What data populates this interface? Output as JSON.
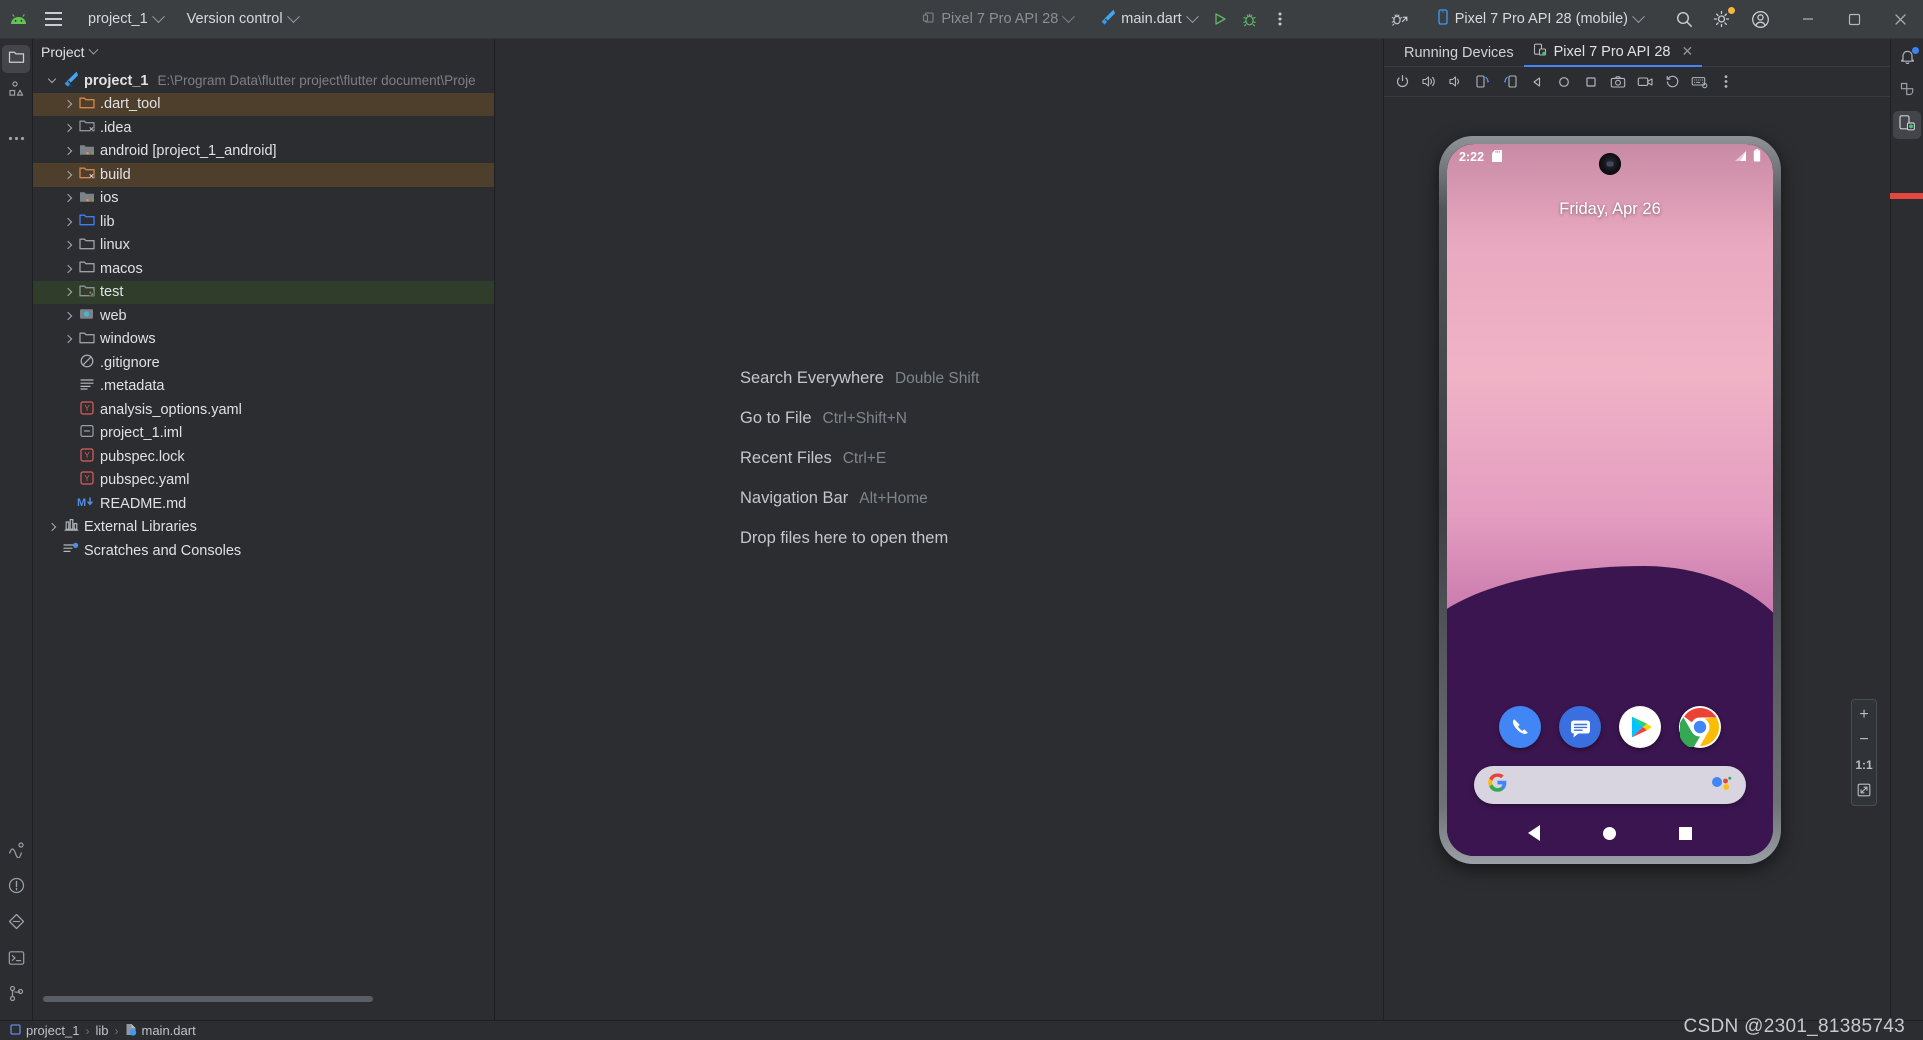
{
  "titlebar": {
    "logo_icon": "android-logo-icon",
    "menu_icon": "hamburger-menu-icon",
    "project_name": "project_1",
    "version_control": "Version control",
    "device_selector_left": "Pixel 7 Pro API 28",
    "run_config": "main.dart",
    "run_icon": "run-play-icon",
    "debug_icon": "debug-bug-icon",
    "more_icon": "more-vertical-icon",
    "flutter_icon": "flutter-logo-icon",
    "device_icon": "device-phone-icon",
    "settings_sync_icon": "debug-attach-icon",
    "device_selector_right": "Pixel 7 Pro API 28 (mobile)",
    "search_icon": "search-icon",
    "settings_icon": "gear-icon",
    "account_icon": "user-account-icon",
    "minimize_icon": "minimize-icon",
    "maximize_icon": "maximize-restore-icon",
    "close_icon": "close-icon"
  },
  "left_rail": {
    "items": [
      {
        "name": "project-tool-window",
        "icon": "folder-icon",
        "active": true
      },
      {
        "name": "structure-tool-window",
        "icon": "structure-shapes-icon",
        "active": false
      },
      {
        "name": "more-tool-windows",
        "icon": "ellipsis-icon",
        "active": false
      }
    ],
    "bottom_items": [
      {
        "name": "profiler-tool-window",
        "icon": "profiler-icon"
      },
      {
        "name": "problems-tool-window",
        "icon": "warning-circle-icon"
      },
      {
        "name": "flutter-inspector",
        "icon": "flutter-diamond-icon"
      },
      {
        "name": "terminal-tool-window",
        "icon": "terminal-icon"
      },
      {
        "name": "version-control-tool-window",
        "icon": "git-branch-icon"
      }
    ]
  },
  "right_rail": {
    "items": [
      {
        "name": "notifications",
        "icon": "bell-icon",
        "badge": true
      },
      {
        "name": "gradle",
        "icon": "gradle-elephant-icon",
        "badge": false
      },
      {
        "name": "running-devices",
        "icon": "running-devices-icon",
        "badge": true,
        "active": true
      }
    ]
  },
  "project_panel": {
    "header": "Project",
    "header_chevron_icon": "chevron-down-icon",
    "tree": [
      {
        "label": "project_1",
        "sub": "E:\\Program Data\\flutter project\\flutter document\\Proje",
        "indent": 0,
        "arrow": "down",
        "icon": "flutter-logo-icon",
        "bold": true,
        "highlight": ""
      },
      {
        "label": ".dart_tool",
        "sub": "",
        "indent": 1,
        "arrow": "right",
        "icon": "folder-orange-icon",
        "bold": false,
        "highlight": "brown"
      },
      {
        "label": ".idea",
        "sub": "",
        "indent": 1,
        "arrow": "right",
        "icon": "folder-excluded-icon",
        "bold": false,
        "highlight": ""
      },
      {
        "label": "android [project_1_android]",
        "sub": "",
        "indent": 1,
        "arrow": "right",
        "icon": "folder-module-icon",
        "bold": false,
        "highlight": ""
      },
      {
        "label": "build",
        "sub": "",
        "indent": 1,
        "arrow": "right",
        "icon": "folder-orange-excluded-icon",
        "bold": false,
        "highlight": "brown"
      },
      {
        "label": "ios",
        "sub": "",
        "indent": 1,
        "arrow": "right",
        "icon": "folder-module-icon",
        "bold": false,
        "highlight": ""
      },
      {
        "label": "lib",
        "sub": "",
        "indent": 1,
        "arrow": "right",
        "icon": "folder-source-icon",
        "bold": false,
        "highlight": ""
      },
      {
        "label": "linux",
        "sub": "",
        "indent": 1,
        "arrow": "right",
        "icon": "folder-icon",
        "bold": false,
        "highlight": ""
      },
      {
        "label": "macos",
        "sub": "",
        "indent": 1,
        "arrow": "right",
        "icon": "folder-icon",
        "bold": false,
        "highlight": ""
      },
      {
        "label": "test",
        "sub": "",
        "indent": 1,
        "arrow": "right",
        "icon": "folder-test-icon",
        "bold": false,
        "highlight": "green"
      },
      {
        "label": "web",
        "sub": "",
        "indent": 1,
        "arrow": "right",
        "icon": "folder-web-icon",
        "bold": false,
        "highlight": ""
      },
      {
        "label": "windows",
        "sub": "",
        "indent": 1,
        "arrow": "right",
        "icon": "folder-icon",
        "bold": false,
        "highlight": ""
      },
      {
        "label": ".gitignore",
        "sub": "",
        "indent": 1,
        "arrow": "",
        "icon": "gitignore-icon",
        "bold": false,
        "highlight": ""
      },
      {
        "label": ".metadata",
        "sub": "",
        "indent": 1,
        "arrow": "",
        "icon": "text-file-icon",
        "bold": false,
        "highlight": ""
      },
      {
        "label": "analysis_options.yaml",
        "sub": "",
        "indent": 1,
        "arrow": "",
        "icon": "yaml-file-icon",
        "bold": false,
        "highlight": ""
      },
      {
        "label": "project_1.iml",
        "sub": "",
        "indent": 1,
        "arrow": "",
        "icon": "iml-file-icon",
        "bold": false,
        "highlight": ""
      },
      {
        "label": "pubspec.lock",
        "sub": "",
        "indent": 1,
        "arrow": "",
        "icon": "yaml-file-icon",
        "bold": false,
        "highlight": ""
      },
      {
        "label": "pubspec.yaml",
        "sub": "",
        "indent": 1,
        "arrow": "",
        "icon": "yaml-file-icon",
        "bold": false,
        "highlight": ""
      },
      {
        "label": "README.md",
        "sub": "",
        "indent": 1,
        "arrow": "",
        "icon": "markdown-file-icon",
        "bold": false,
        "highlight": ""
      },
      {
        "label": "External Libraries",
        "sub": "",
        "indent": 0,
        "arrow": "right",
        "icon": "library-icon",
        "bold": false,
        "highlight": ""
      },
      {
        "label": "Scratches and Consoles",
        "sub": "",
        "indent": 0,
        "arrow": "",
        "icon": "scratches-icon",
        "bold": false,
        "highlight": ""
      }
    ]
  },
  "editor": {
    "shortcuts": [
      {
        "name": "Search Everywhere",
        "key": "Double Shift"
      },
      {
        "name": "Go to File",
        "key": "Ctrl+Shift+N"
      },
      {
        "name": "Recent Files",
        "key": "Ctrl+E"
      },
      {
        "name": "Navigation Bar",
        "key": "Alt+Home"
      },
      {
        "name": "Drop files here to open them",
        "key": ""
      }
    ]
  },
  "devices_panel": {
    "title": "Running Devices",
    "tab_label": "Pixel 7 Pro API 28",
    "tab_icon": "device-running-icon",
    "tab_close_icon": "close-icon",
    "toolbar": [
      {
        "name": "power-button",
        "icon": "power-icon"
      },
      {
        "name": "volume-up-button",
        "icon": "volume-up-icon"
      },
      {
        "name": "volume-down-button",
        "icon": "volume-down-icon"
      },
      {
        "name": "rotate-left-button",
        "icon": "rotate-left-icon"
      },
      {
        "name": "rotate-right-button",
        "icon": "rotate-right-icon"
      },
      {
        "name": "back-button",
        "icon": "back-triangle-icon"
      },
      {
        "name": "home-button",
        "icon": "home-circle-icon"
      },
      {
        "name": "overview-button",
        "icon": "overview-square-icon"
      },
      {
        "name": "screenshot-button",
        "icon": "camera-icon"
      },
      {
        "name": "record-button",
        "icon": "video-camera-icon"
      },
      {
        "name": "rollback-button",
        "icon": "history-rollback-icon"
      },
      {
        "name": "hardware-input-button",
        "icon": "keyboard-icon"
      },
      {
        "name": "more-options-button",
        "icon": "more-vertical-icon"
      }
    ],
    "zoom_controls": {
      "zoom_in": "+",
      "zoom_out": "−",
      "actual_size": "1:1",
      "fit_icon": "zoom-to-fit-icon"
    }
  },
  "emulator": {
    "status_time": "2:22",
    "status_icons_left": [
      "sd-card-icon"
    ],
    "status_icons_right": [
      "signal-icon",
      "battery-icon"
    ],
    "date_text": "Friday, Apr 26",
    "dock_apps": [
      {
        "name": "phone-app-icon",
        "label": "Phone",
        "color": "#4285F4"
      },
      {
        "name": "messages-app-icon",
        "label": "Messages",
        "color": "#3a6fe0"
      },
      {
        "name": "play-store-app-icon",
        "label": "Play Store",
        "color": "#ffffff"
      },
      {
        "name": "chrome-app-icon",
        "label": "Chrome",
        "color": "#ffffff"
      }
    ],
    "search_widget": {
      "google_icon": "google-g-icon",
      "assistant_icon": "google-assistant-icon",
      "placeholder": ""
    },
    "nav_buttons": [
      {
        "name": "nav-back-button",
        "icon": "triangle-back-icon"
      },
      {
        "name": "nav-home-button",
        "icon": "circle-home-icon"
      },
      {
        "name": "nav-recents-button",
        "icon": "square-recents-icon"
      }
    ]
  },
  "statusbar": {
    "breadcrumbs": [
      "project_1",
      "lib",
      "main.dart"
    ],
    "project_icon": "module-icon",
    "file_icon": "dart-file-icon",
    "separator": "›"
  },
  "watermark": "CSDN @2301_81385743",
  "colors": {
    "accent_blue": "#4682fa",
    "toolbar_bg": "#3c3f41",
    "panel_bg": "#2b2d30",
    "highlight_brown": "#4e3f2d",
    "highlight_green": "#2f3d2a",
    "notification_red": "#e2483d"
  }
}
